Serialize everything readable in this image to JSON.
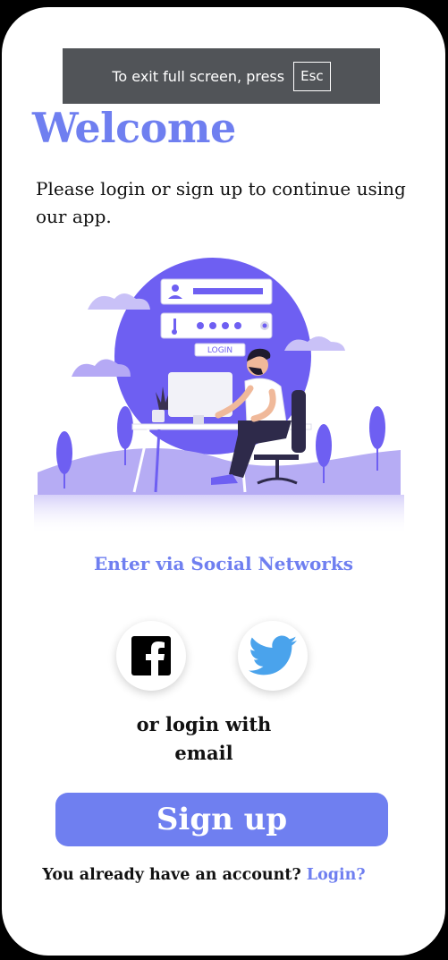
{
  "banner": {
    "text": "To exit full screen, press",
    "key": "Esc"
  },
  "welcome": {
    "title": "Welcome",
    "subtitle": "Please login or sign up to continue using our app.",
    "illustration_label": "LOGIN"
  },
  "social": {
    "heading": "Enter via Social Networks",
    "facebook_icon": "facebook-icon",
    "twitter_icon": "twitter-icon"
  },
  "email": {
    "line1": "or login with",
    "line2": "email"
  },
  "signup": {
    "label": "Sign up"
  },
  "account": {
    "prompt": "You already have an account?",
    "link": "Login?"
  },
  "colors": {
    "accent": "#6f7ff0",
    "illustration": "#6e5ff2",
    "facebook": "#000000",
    "twitter": "#4aa3ec"
  }
}
